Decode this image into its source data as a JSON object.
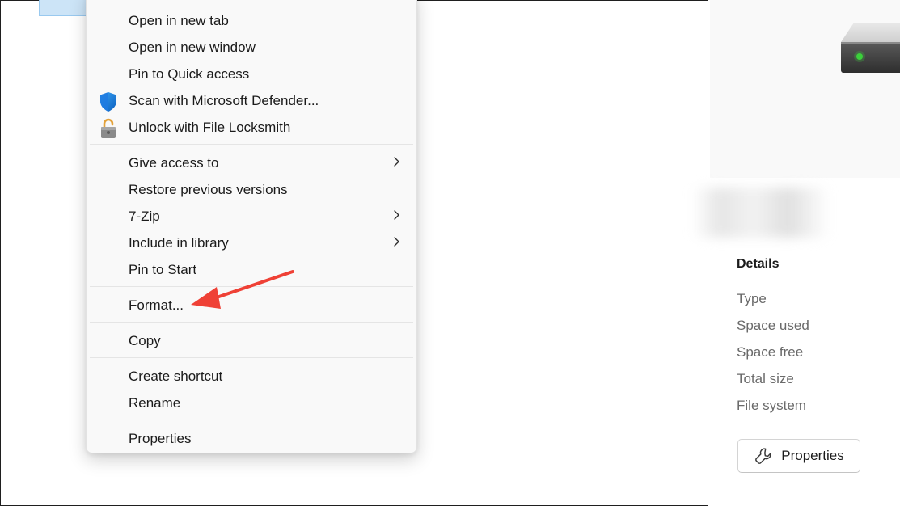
{
  "context_menu": {
    "items": [
      {
        "label": "Open in new tab"
      },
      {
        "label": "Open in new window"
      },
      {
        "label": "Pin to Quick access"
      },
      {
        "label": "Scan with Microsoft Defender...",
        "icon": "defender-shield-icon"
      },
      {
        "label": "Unlock with File Locksmith",
        "icon": "padlock-icon"
      },
      {
        "label": "Give access to",
        "submenu": true
      },
      {
        "label": "Restore previous versions"
      },
      {
        "label": "7-Zip",
        "submenu": true
      },
      {
        "label": "Include in library",
        "submenu": true
      },
      {
        "label": "Pin to Start"
      },
      {
        "label": "Format..."
      },
      {
        "label": "Copy"
      },
      {
        "label": "Create shortcut"
      },
      {
        "label": "Rename"
      },
      {
        "label": "Properties"
      }
    ]
  },
  "details_pane": {
    "title": "Details",
    "fields": [
      "Type",
      "Space used",
      "Space free",
      "Total size",
      "File system"
    ],
    "properties_button": "Properties"
  },
  "colors": {
    "annotation_arrow": "#ef4136",
    "menu_background": "#f9f9f9",
    "drive_led": "#3bd13b"
  }
}
